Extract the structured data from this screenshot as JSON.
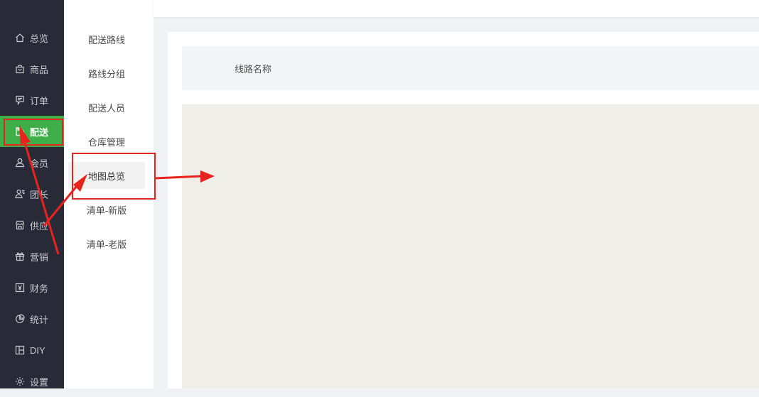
{
  "sidebar": {
    "items": [
      {
        "label": "总览",
        "icon": "home-icon"
      },
      {
        "label": "商品",
        "icon": "shopping-bag-icon"
      },
      {
        "label": "订单",
        "icon": "receipt-icon"
      },
      {
        "label": "配送",
        "icon": "delivery-icon",
        "active": true
      },
      {
        "label": "会员",
        "icon": "user-icon"
      },
      {
        "label": "团长",
        "icon": "leader-icon"
      },
      {
        "label": "供应",
        "icon": "store-icon"
      },
      {
        "label": "营销",
        "icon": "gift-icon"
      },
      {
        "label": "财务",
        "icon": "yen-icon"
      },
      {
        "label": "统计",
        "icon": "pie-chart-icon"
      },
      {
        "label": "DIY",
        "icon": "layout-icon"
      },
      {
        "label": "设置",
        "icon": "gear-icon"
      }
    ]
  },
  "submenu": {
    "items": [
      {
        "label": "配送路线"
      },
      {
        "label": "路线分组"
      },
      {
        "label": "配送人员"
      },
      {
        "label": "仓库管理"
      },
      {
        "label": "地图总览",
        "active": true
      },
      {
        "label": "清单-新版"
      },
      {
        "label": "清单-老版"
      }
    ]
  },
  "main": {
    "table_header": {
      "column_1": "线路名称"
    }
  },
  "colors": {
    "nav_bg": "#282a37",
    "active_green": "#3eaf48",
    "annotation_red": "#e8231d",
    "map_bg": "#f0eee9"
  }
}
